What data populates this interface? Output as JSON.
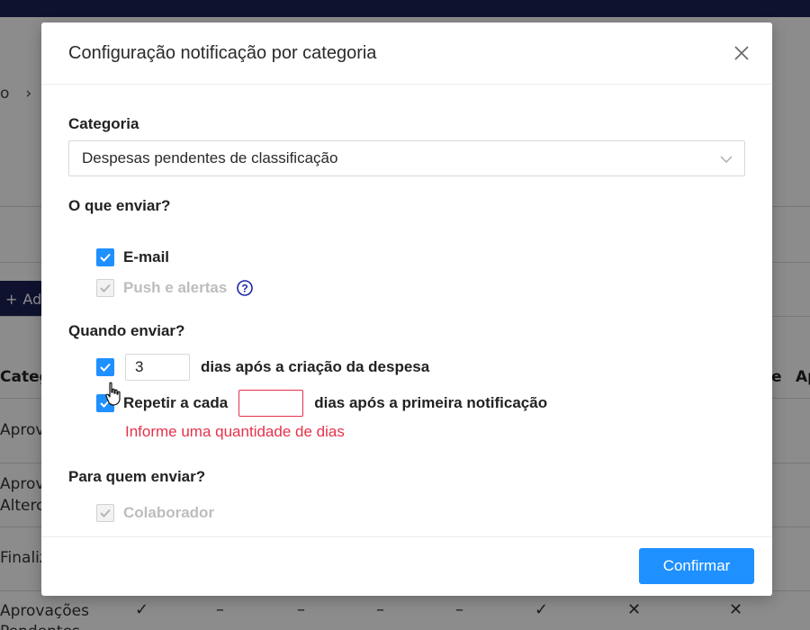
{
  "background": {
    "breadcrumb_fragment": "o",
    "add_button_label": "Ad",
    "table_header_left": "Categ",
    "table_header_right_1": "e",
    "table_header_right_2": "Ap",
    "rows": [
      "Aprov",
      "Aprov",
      "Alterc",
      "Finaliz",
      "Aprovações",
      "Pendentes"
    ]
  },
  "modal": {
    "title": "Configuração notificação por categoria",
    "category": {
      "label": "Categoria",
      "selected": "Despesas pendentes de classificação"
    },
    "what_to_send": {
      "label": "O que enviar?",
      "email": {
        "label": "E-mail",
        "checked": true
      },
      "push": {
        "label": "Push e alertas",
        "checked": true,
        "disabled": true
      }
    },
    "when_to_send": {
      "label": "Quando enviar?",
      "days_after_creation": {
        "checked": true,
        "value": "3",
        "suffix": "dias após a criação da despesa"
      },
      "repeat": {
        "checked": true,
        "prefix": "Repetir a cada",
        "value": "",
        "suffix": "dias após a primeira notificação",
        "error": "Informe uma quantidade de dias"
      }
    },
    "to_whom": {
      "label": "Para quem enviar?",
      "collaborator": {
        "label": "Colaborador",
        "checked": true,
        "disabled": true
      }
    },
    "confirm_label": "Confirmar"
  },
  "colors": {
    "primary": "#1e90ff",
    "error": "#e5324a",
    "topbar": "#1d2156"
  }
}
